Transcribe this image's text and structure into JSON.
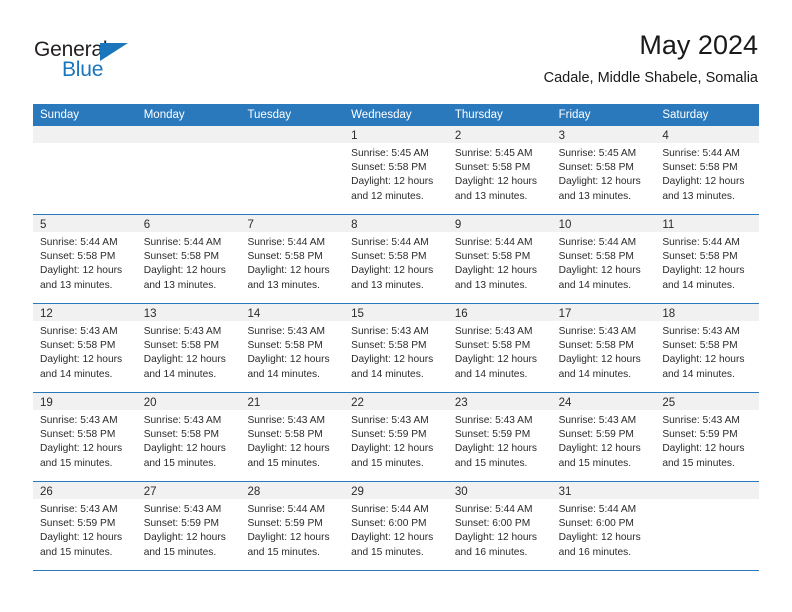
{
  "brand": {
    "name_top": "General",
    "name_bottom": "Blue",
    "triangle_icon": "triangle-icon",
    "accent_color": "#1b75bb"
  },
  "header": {
    "title": "May 2024",
    "subtitle": "Cadale, Middle Shabele, Somalia"
  },
  "calendar": {
    "header_bg": "#2b79bd",
    "daynum_band_bg": "#f1f1f1",
    "weekday_headers": [
      "Sunday",
      "Monday",
      "Tuesday",
      "Wednesday",
      "Thursday",
      "Friday",
      "Saturday"
    ],
    "weeks": [
      [
        {
          "day": "",
          "sunrise": "",
          "sunset": "",
          "daylight_1": "",
          "daylight_2": ""
        },
        {
          "day": "",
          "sunrise": "",
          "sunset": "",
          "daylight_1": "",
          "daylight_2": ""
        },
        {
          "day": "",
          "sunrise": "",
          "sunset": "",
          "daylight_1": "",
          "daylight_2": ""
        },
        {
          "day": "1",
          "sunrise": "Sunrise: 5:45 AM",
          "sunset": "Sunset: 5:58 PM",
          "daylight_1": "Daylight: 12 hours",
          "daylight_2": "and 12 minutes."
        },
        {
          "day": "2",
          "sunrise": "Sunrise: 5:45 AM",
          "sunset": "Sunset: 5:58 PM",
          "daylight_1": "Daylight: 12 hours",
          "daylight_2": "and 13 minutes."
        },
        {
          "day": "3",
          "sunrise": "Sunrise: 5:45 AM",
          "sunset": "Sunset: 5:58 PM",
          "daylight_1": "Daylight: 12 hours",
          "daylight_2": "and 13 minutes."
        },
        {
          "day": "4",
          "sunrise": "Sunrise: 5:44 AM",
          "sunset": "Sunset: 5:58 PM",
          "daylight_1": "Daylight: 12 hours",
          "daylight_2": "and 13 minutes."
        }
      ],
      [
        {
          "day": "5",
          "sunrise": "Sunrise: 5:44 AM",
          "sunset": "Sunset: 5:58 PM",
          "daylight_1": "Daylight: 12 hours",
          "daylight_2": "and 13 minutes."
        },
        {
          "day": "6",
          "sunrise": "Sunrise: 5:44 AM",
          "sunset": "Sunset: 5:58 PM",
          "daylight_1": "Daylight: 12 hours",
          "daylight_2": "and 13 minutes."
        },
        {
          "day": "7",
          "sunrise": "Sunrise: 5:44 AM",
          "sunset": "Sunset: 5:58 PM",
          "daylight_1": "Daylight: 12 hours",
          "daylight_2": "and 13 minutes."
        },
        {
          "day": "8",
          "sunrise": "Sunrise: 5:44 AM",
          "sunset": "Sunset: 5:58 PM",
          "daylight_1": "Daylight: 12 hours",
          "daylight_2": "and 13 minutes."
        },
        {
          "day": "9",
          "sunrise": "Sunrise: 5:44 AM",
          "sunset": "Sunset: 5:58 PM",
          "daylight_1": "Daylight: 12 hours",
          "daylight_2": "and 13 minutes."
        },
        {
          "day": "10",
          "sunrise": "Sunrise: 5:44 AM",
          "sunset": "Sunset: 5:58 PM",
          "daylight_1": "Daylight: 12 hours",
          "daylight_2": "and 14 minutes."
        },
        {
          "day": "11",
          "sunrise": "Sunrise: 5:44 AM",
          "sunset": "Sunset: 5:58 PM",
          "daylight_1": "Daylight: 12 hours",
          "daylight_2": "and 14 minutes."
        }
      ],
      [
        {
          "day": "12",
          "sunrise": "Sunrise: 5:43 AM",
          "sunset": "Sunset: 5:58 PM",
          "daylight_1": "Daylight: 12 hours",
          "daylight_2": "and 14 minutes."
        },
        {
          "day": "13",
          "sunrise": "Sunrise: 5:43 AM",
          "sunset": "Sunset: 5:58 PM",
          "daylight_1": "Daylight: 12 hours",
          "daylight_2": "and 14 minutes."
        },
        {
          "day": "14",
          "sunrise": "Sunrise: 5:43 AM",
          "sunset": "Sunset: 5:58 PM",
          "daylight_1": "Daylight: 12 hours",
          "daylight_2": "and 14 minutes."
        },
        {
          "day": "15",
          "sunrise": "Sunrise: 5:43 AM",
          "sunset": "Sunset: 5:58 PM",
          "daylight_1": "Daylight: 12 hours",
          "daylight_2": "and 14 minutes."
        },
        {
          "day": "16",
          "sunrise": "Sunrise: 5:43 AM",
          "sunset": "Sunset: 5:58 PM",
          "daylight_1": "Daylight: 12 hours",
          "daylight_2": "and 14 minutes."
        },
        {
          "day": "17",
          "sunrise": "Sunrise: 5:43 AM",
          "sunset": "Sunset: 5:58 PM",
          "daylight_1": "Daylight: 12 hours",
          "daylight_2": "and 14 minutes."
        },
        {
          "day": "18",
          "sunrise": "Sunrise: 5:43 AM",
          "sunset": "Sunset: 5:58 PM",
          "daylight_1": "Daylight: 12 hours",
          "daylight_2": "and 14 minutes."
        }
      ],
      [
        {
          "day": "19",
          "sunrise": "Sunrise: 5:43 AM",
          "sunset": "Sunset: 5:58 PM",
          "daylight_1": "Daylight: 12 hours",
          "daylight_2": "and 15 minutes."
        },
        {
          "day": "20",
          "sunrise": "Sunrise: 5:43 AM",
          "sunset": "Sunset: 5:58 PM",
          "daylight_1": "Daylight: 12 hours",
          "daylight_2": "and 15 minutes."
        },
        {
          "day": "21",
          "sunrise": "Sunrise: 5:43 AM",
          "sunset": "Sunset: 5:58 PM",
          "daylight_1": "Daylight: 12 hours",
          "daylight_2": "and 15 minutes."
        },
        {
          "day": "22",
          "sunrise": "Sunrise: 5:43 AM",
          "sunset": "Sunset: 5:59 PM",
          "daylight_1": "Daylight: 12 hours",
          "daylight_2": "and 15 minutes."
        },
        {
          "day": "23",
          "sunrise": "Sunrise: 5:43 AM",
          "sunset": "Sunset: 5:59 PM",
          "daylight_1": "Daylight: 12 hours",
          "daylight_2": "and 15 minutes."
        },
        {
          "day": "24",
          "sunrise": "Sunrise: 5:43 AM",
          "sunset": "Sunset: 5:59 PM",
          "daylight_1": "Daylight: 12 hours",
          "daylight_2": "and 15 minutes."
        },
        {
          "day": "25",
          "sunrise": "Sunrise: 5:43 AM",
          "sunset": "Sunset: 5:59 PM",
          "daylight_1": "Daylight: 12 hours",
          "daylight_2": "and 15 minutes."
        }
      ],
      [
        {
          "day": "26",
          "sunrise": "Sunrise: 5:43 AM",
          "sunset": "Sunset: 5:59 PM",
          "daylight_1": "Daylight: 12 hours",
          "daylight_2": "and 15 minutes."
        },
        {
          "day": "27",
          "sunrise": "Sunrise: 5:43 AM",
          "sunset": "Sunset: 5:59 PM",
          "daylight_1": "Daylight: 12 hours",
          "daylight_2": "and 15 minutes."
        },
        {
          "day": "28",
          "sunrise": "Sunrise: 5:44 AM",
          "sunset": "Sunset: 5:59 PM",
          "daylight_1": "Daylight: 12 hours",
          "daylight_2": "and 15 minutes."
        },
        {
          "day": "29",
          "sunrise": "Sunrise: 5:44 AM",
          "sunset": "Sunset: 6:00 PM",
          "daylight_1": "Daylight: 12 hours",
          "daylight_2": "and 15 minutes."
        },
        {
          "day": "30",
          "sunrise": "Sunrise: 5:44 AM",
          "sunset": "Sunset: 6:00 PM",
          "daylight_1": "Daylight: 12 hours",
          "daylight_2": "and 16 minutes."
        },
        {
          "day": "31",
          "sunrise": "Sunrise: 5:44 AM",
          "sunset": "Sunset: 6:00 PM",
          "daylight_1": "Daylight: 12 hours",
          "daylight_2": "and 16 minutes."
        },
        {
          "day": "",
          "sunrise": "",
          "sunset": "",
          "daylight_1": "",
          "daylight_2": ""
        }
      ]
    ]
  }
}
